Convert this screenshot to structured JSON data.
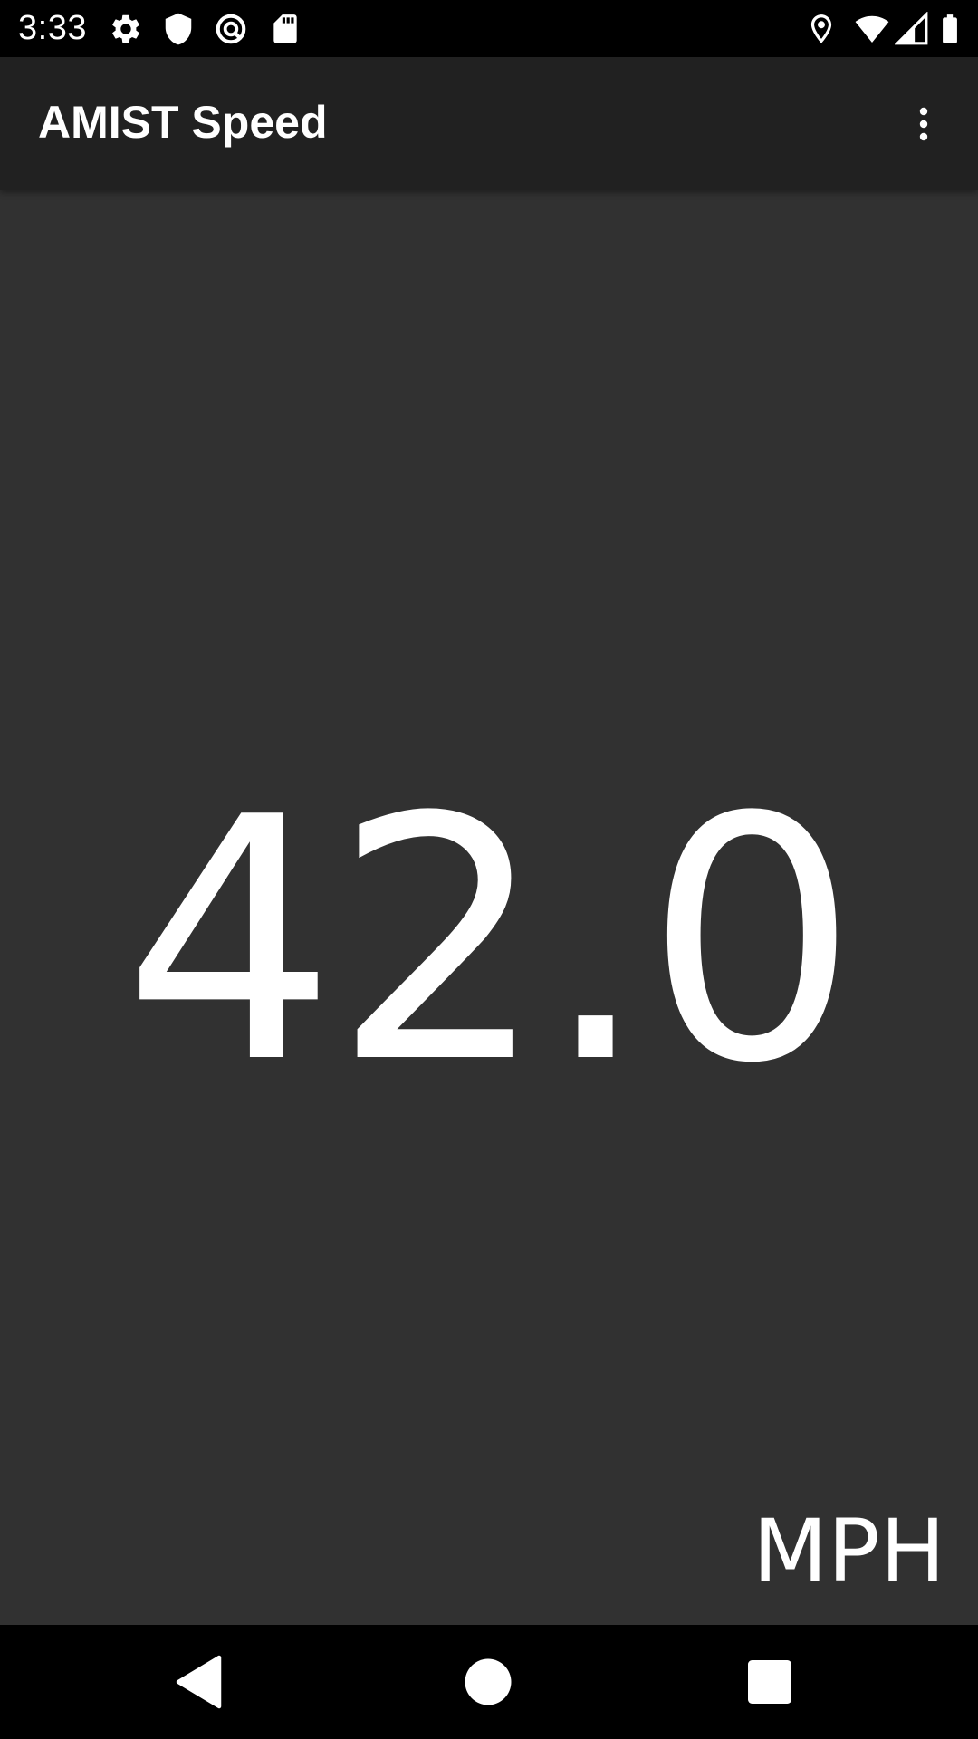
{
  "status_bar": {
    "time": "3:33",
    "left_icons": [
      "settings-icon",
      "shield-icon",
      "sync-icon",
      "sd-card-icon"
    ],
    "right_icons": [
      "location-icon",
      "wifi-icon",
      "cell-signal-icon",
      "battery-icon"
    ]
  },
  "app_bar": {
    "title": "AMIST Speed",
    "overflow_icon": "more-vert-icon"
  },
  "speedometer": {
    "value": "42.0",
    "unit": "MPH"
  },
  "nav_bar": {
    "buttons": [
      "back-icon",
      "home-icon",
      "recents-icon"
    ]
  },
  "colors": {
    "status_bar": "#000000",
    "app_bar": "#212121",
    "content_background": "#313131",
    "text": "#ffffff",
    "nav_bar": "#000000"
  }
}
